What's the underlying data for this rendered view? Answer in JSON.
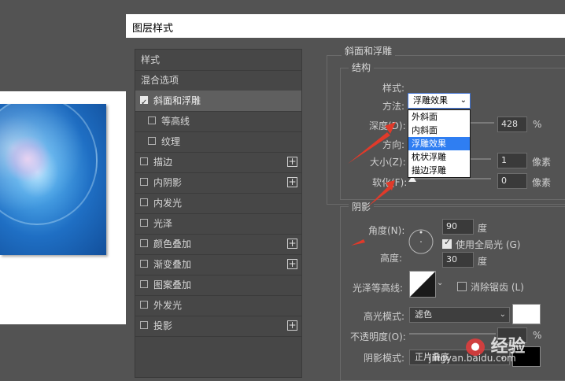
{
  "dialog": {
    "title": "图层样式"
  },
  "left_panel": {
    "header": "样式",
    "blend_options": "混合选项",
    "items": [
      {
        "label": "斜面和浮雕",
        "checked": true,
        "selected": true
      },
      {
        "label": "等高线",
        "checked": false,
        "sub": true
      },
      {
        "label": "纹理",
        "checked": false,
        "sub": true
      },
      {
        "label": "描边",
        "checked": false,
        "plus": true
      },
      {
        "label": "内阴影",
        "checked": false,
        "plus": true
      },
      {
        "label": "内发光",
        "checked": false
      },
      {
        "label": "光泽",
        "checked": false
      },
      {
        "label": "颜色叠加",
        "checked": false,
        "plus": true
      },
      {
        "label": "渐变叠加",
        "checked": false,
        "plus": true
      },
      {
        "label": "图案叠加",
        "checked": false
      },
      {
        "label": "外发光",
        "checked": false
      },
      {
        "label": "投影",
        "checked": false,
        "plus": true
      }
    ]
  },
  "bevel": {
    "group_title": "斜面和浮雕",
    "structure_title": "结构",
    "style_label": "样式:",
    "style_value": "浮雕效果",
    "style_options": [
      "外斜面",
      "内斜面",
      "浮雕效果",
      "枕状浮雕",
      "描边浮雕"
    ],
    "method_label": "方法:",
    "depth_label": "深度(D):",
    "depth_value": "428",
    "depth_unit": "%",
    "direction_label": "方向:",
    "size_label": "大小(Z):",
    "size_value": "1",
    "size_unit": "像素",
    "soften_label": "软化(F):",
    "soften_value": "0",
    "soften_unit": "像素"
  },
  "shading": {
    "title": "阴影",
    "angle_label": "角度(N):",
    "angle_value": "90",
    "angle_unit": "度",
    "global_light_label": "使用全局光 (G)",
    "global_light_checked": true,
    "altitude_label": "高度:",
    "altitude_value": "30",
    "altitude_unit": "度",
    "gloss_label": "光泽等高线:",
    "antialias_label": "消除锯齿 (L)",
    "antialias_checked": false,
    "highlight_mode_label": "高光模式:",
    "highlight_mode_value": "滤色",
    "highlight_color": "#ffffff",
    "opacity_label": "不透明度(O):",
    "opacity_value": "%",
    "shadow_mode_label": "阴影模式:",
    "shadow_mode_value": "正片叠底",
    "shadow_color": "#000000"
  },
  "watermark": {
    "text": "经验",
    "url": "jingyan.baidu.com"
  }
}
